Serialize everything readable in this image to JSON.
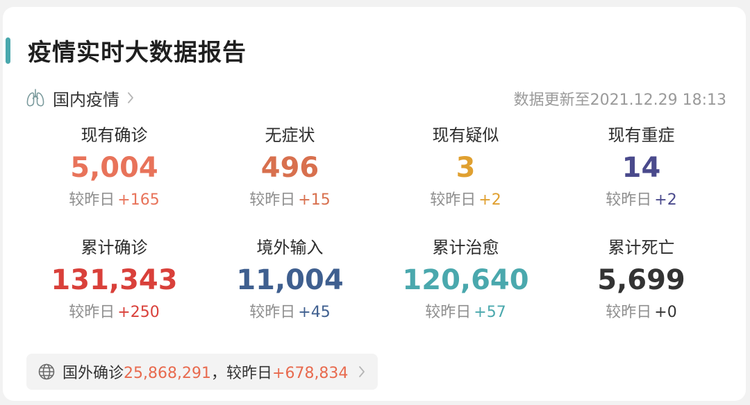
{
  "header": {
    "title": "疫情实时大数据报告",
    "accent_color": "#4aa8ad"
  },
  "domestic": {
    "label": "国内疫情",
    "icon": "lungs-icon",
    "update_time": "数据更新至2021.12.29 18:13"
  },
  "stats": [
    {
      "label": "现有确诊",
      "value": "5,004",
      "delta_prefix": "较昨日",
      "delta": "+165",
      "color": "#e8735a",
      "delta_color": "#e8735a"
    },
    {
      "label": "无症状",
      "value": "496",
      "delta_prefix": "较昨日",
      "delta": "+15",
      "color": "#d8704e",
      "delta_color": "#d8704e"
    },
    {
      "label": "现有疑似",
      "value": "3",
      "delta_prefix": "较昨日",
      "delta": "+2",
      "color": "#e0a030",
      "delta_color": "#e0a030"
    },
    {
      "label": "现有重症",
      "value": "14",
      "delta_prefix": "较昨日",
      "delta": "+2",
      "color": "#4a4a8c",
      "delta_color": "#4a4a8c"
    },
    {
      "label": "累计确诊",
      "value": "131,343",
      "delta_prefix": "较昨日",
      "delta": "+250",
      "color": "#d9403a",
      "delta_color": "#d9403a"
    },
    {
      "label": "境外输入",
      "value": "11,004",
      "delta_prefix": "较昨日",
      "delta": "+45",
      "color": "#3f5f8f",
      "delta_color": "#3f5f8f"
    },
    {
      "label": "累计治愈",
      "value": "120,640",
      "delta_prefix": "较昨日",
      "delta": "+57",
      "color": "#4aa8ad",
      "delta_color": "#4aa8ad"
    },
    {
      "label": "累计死亡",
      "value": "5,699",
      "delta_prefix": "较昨日",
      "delta": "+0",
      "color": "#333333",
      "delta_color": "#333333"
    }
  ],
  "foreign": {
    "icon": "globe-icon",
    "label": "国外确诊",
    "value": "25,868,291",
    "separator": "，",
    "delta_prefix": "较昨日",
    "delta": "+678,834"
  }
}
